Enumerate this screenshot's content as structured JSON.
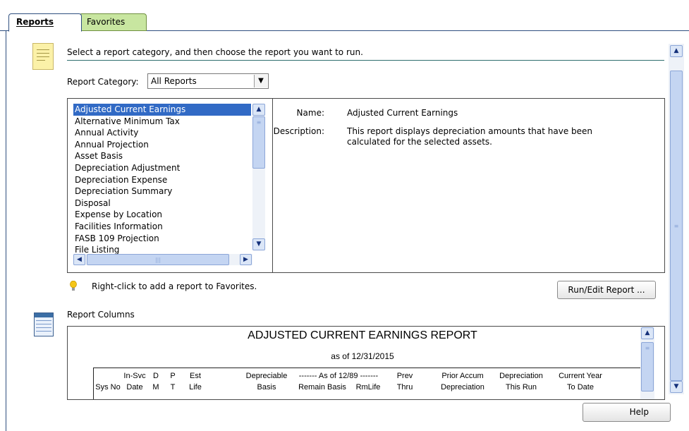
{
  "tabs": [
    {
      "label": "Reports",
      "active": true
    },
    {
      "label": "Favorites",
      "active": false
    }
  ],
  "instruction": "Select a report category, and then choose the report you want to run.",
  "category": {
    "label": "Report Category:",
    "value": "All Reports"
  },
  "reports": [
    "Adjusted Current Earnings",
    "Alternative Minimum Tax",
    "Annual Activity",
    "Annual Projection",
    "Asset Basis",
    "Depreciation Adjustment",
    "Depreciation Expense",
    "Depreciation Summary",
    "Disposal",
    "Expense by Location",
    "Facilities Information",
    "FASB 109 Projection",
    "File Listing"
  ],
  "selected_report_index": 0,
  "details": {
    "name_label": "Name:",
    "name_value": "Adjusted Current Earnings",
    "description_label": "Description:",
    "description_line1": "This report displays depreciation amounts that have been",
    "description_line2": "calculated for the selected assets."
  },
  "hint": "Right-click to add a report to Favorites.",
  "run_button": "Run/Edit Report ...",
  "columns_label": "Report Columns",
  "preview": {
    "title": "ADJUSTED CURRENT EARNINGS REPORT",
    "subtitle": "as of 12/31/2015",
    "columns": [
      {
        "line1": "",
        "line2": "Sys No"
      },
      {
        "line1": "In-Svc",
        "line2": "Date"
      },
      {
        "line1": "D",
        "line2": "M"
      },
      {
        "line1": "P",
        "line2": "T"
      },
      {
        "line1": "Est",
        "line2": "Life"
      },
      {
        "line1": "Depreciable",
        "line2": "Basis"
      },
      {
        "line1": "------- As of 12/89 -------",
        "line2": ""
      },
      {
        "line1": "",
        "line2": "Remain Basis"
      },
      {
        "line1": "",
        "line2": "RmLife"
      },
      {
        "line1": "Prev",
        "line2": "Thru"
      },
      {
        "line1": "Prior Accum",
        "line2": "Depreciation"
      },
      {
        "line1": "Depreciation",
        "line2": "This Run"
      },
      {
        "line1": "Current Year",
        "line2": "To Date"
      }
    ]
  },
  "help_button": "Help",
  "colors": {
    "selection": "#316ac5",
    "favorites_tab": "#c8e6a0",
    "frame": "#2f4f7f"
  },
  "icons": [
    "note-icon",
    "report-columns-icon",
    "lightbulb-icon",
    "scroll-up-icon",
    "scroll-down-icon",
    "scroll-left-icon",
    "scroll-right-icon",
    "dropdown-arrow-icon"
  ]
}
